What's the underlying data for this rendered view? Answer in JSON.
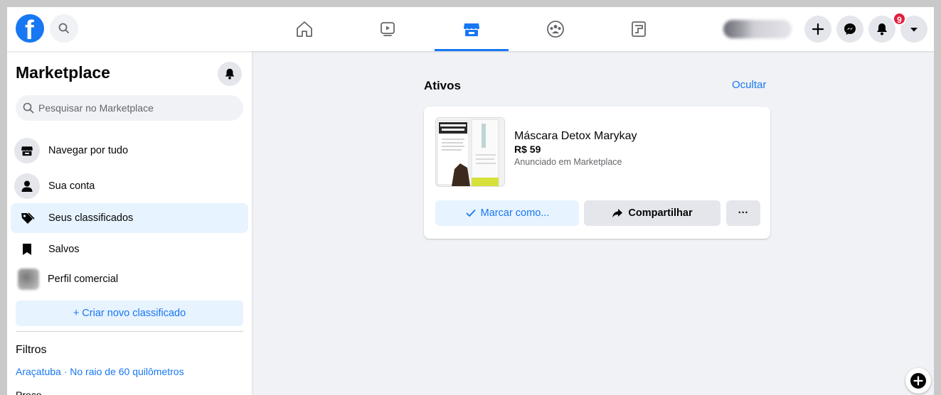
{
  "topbar": {
    "logo_letter": "f",
    "notification_count": "9"
  },
  "sidebar": {
    "title": "Marketplace",
    "search_placeholder": "Pesquisar no Marketplace",
    "items": [
      {
        "label": "Navegar por tudo",
        "icon": "storefront-icon"
      },
      {
        "label": "Sua conta",
        "icon": "person-icon"
      },
      {
        "label": "Seus classificados",
        "icon": "tag-icon"
      },
      {
        "label": "Salvos",
        "icon": "bookmark-icon"
      },
      {
        "label": "Perfil comercial",
        "icon": "avatar"
      }
    ],
    "create_button": "+ Criar novo classificado",
    "filters_title": "Filtros",
    "location": "Araçatuba · No raio de 60 quilômetros",
    "price_title": "Preço"
  },
  "main": {
    "section_title": "Ativos",
    "hide_link": "Ocultar",
    "listing": {
      "title": "Máscara Detox Marykay",
      "price": "R$ 59",
      "subtitle": "Anunciado em Marketplace",
      "mark_button": "Marcar como...",
      "share_button": "Compartilhar",
      "more_button": "···"
    }
  },
  "colors": {
    "brand": "#1877f2",
    "badge": "#e41e3f",
    "background": "#f0f2f5"
  }
}
